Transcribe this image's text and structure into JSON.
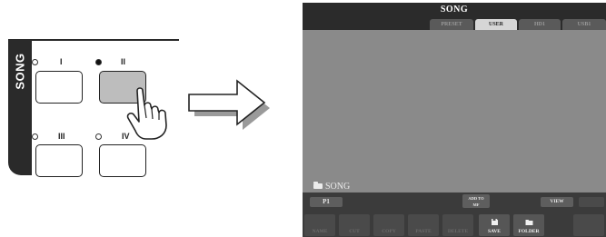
{
  "panel": {
    "label": "SONG",
    "buttons": [
      {
        "number": "I",
        "lamp": "off",
        "pressed": false
      },
      {
        "number": "II",
        "lamp": "on",
        "pressed": true
      },
      {
        "number": "III",
        "lamp": "off",
        "pressed": false
      },
      {
        "number": "IV",
        "lamp": "off",
        "pressed": false
      }
    ]
  },
  "screen": {
    "title": "SONG",
    "tabs": [
      {
        "label": "PRESET",
        "active": false
      },
      {
        "label": "USER",
        "active": true
      },
      {
        "label": "HD1",
        "active": false
      },
      {
        "label": "USB1",
        "active": false
      }
    ],
    "folder_path": "SONG",
    "buttons": {
      "page": "P1",
      "add_to_mf": "ADD TO\nMF",
      "view": "VIEW"
    },
    "functions": [
      {
        "label": "NAME",
        "lit": false,
        "icon": "name-icon"
      },
      {
        "label": "CUT",
        "lit": false,
        "icon": "cut-icon"
      },
      {
        "label": "COPY",
        "lit": false,
        "icon": "copy-icon"
      },
      {
        "label": "PASTE",
        "lit": false,
        "icon": "paste-icon"
      },
      {
        "label": "DELETE",
        "lit": false,
        "icon": "delete-icon"
      },
      {
        "label": "SAVE",
        "lit": true,
        "icon": "save-icon"
      },
      {
        "label": "FOLDER",
        "lit": true,
        "icon": "folder-icon"
      }
    ]
  }
}
